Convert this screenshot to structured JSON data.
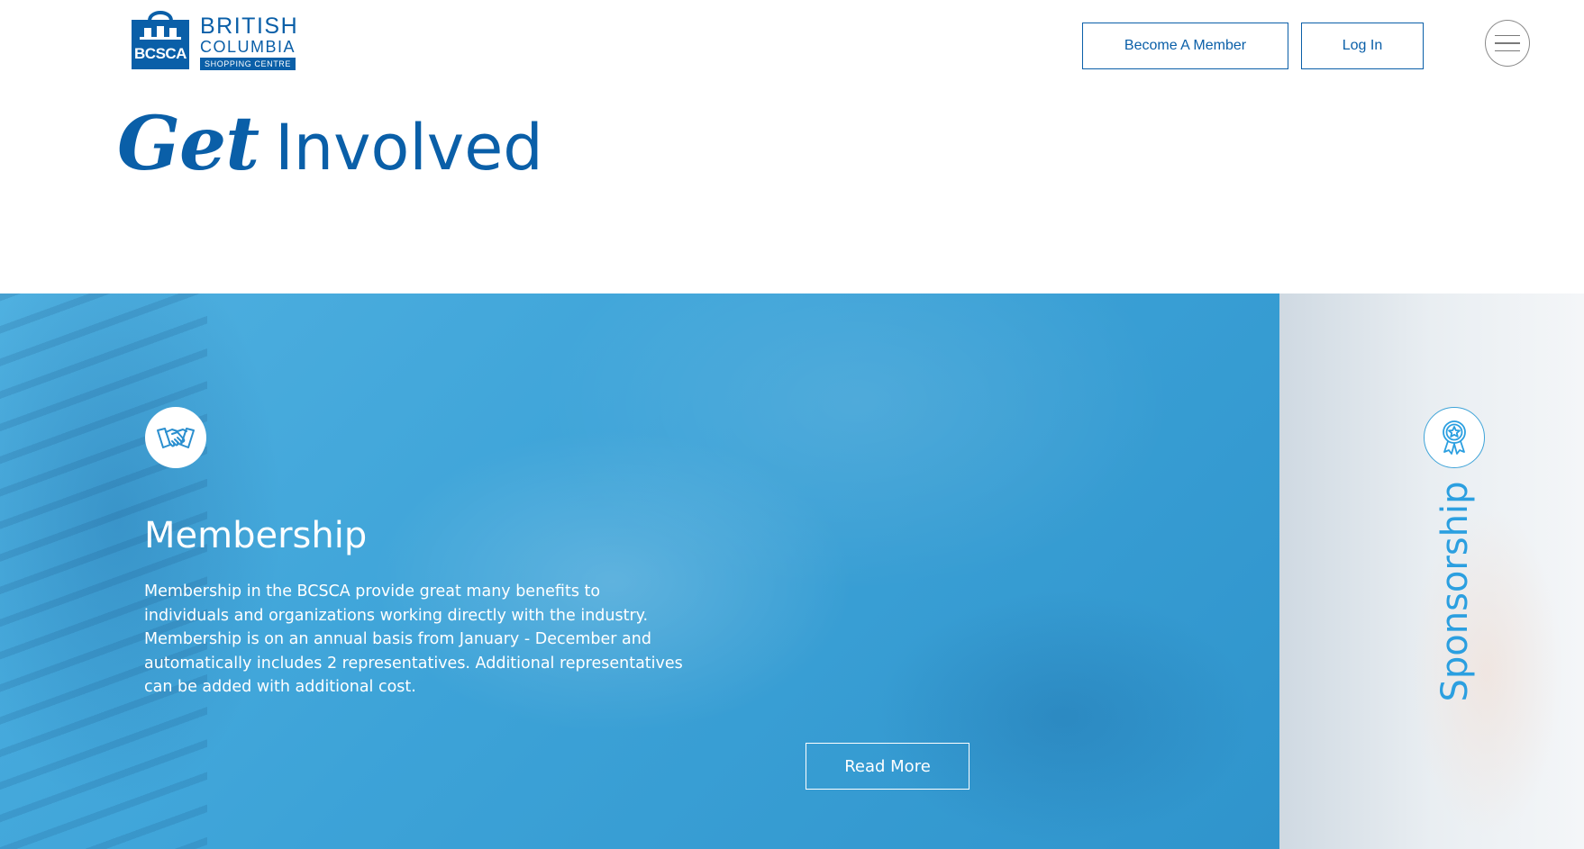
{
  "logo": {
    "bag_text": "BCSCA",
    "line1": "BRITISH",
    "line2": "COLUMBIA",
    "line3": "SHOPPING CENTRE"
  },
  "header": {
    "become_member_label": "Become A Member",
    "login_label": "Log In",
    "menu_icon": "hamburger-menu-icon"
  },
  "title": {
    "script": "Get",
    "main": "Involved"
  },
  "membership": {
    "icon": "handshake-icon",
    "heading": "Membership",
    "description": "Membership in the BCSCA provide great many benefits to individuals and organizations working directly with the industry. Membership is on an annual basis from January - December and automatically includes 2 representatives. Additional representatives can be added with additional cost.",
    "button_label": "Read More"
  },
  "sponsorship": {
    "icon": "award-ribbon-icon",
    "label": "Sponsorship"
  },
  "colors": {
    "brand_blue": "#0a5fa8",
    "panel_blue": "#3da3d8",
    "sponsorship_text": "#2b9fe0"
  }
}
